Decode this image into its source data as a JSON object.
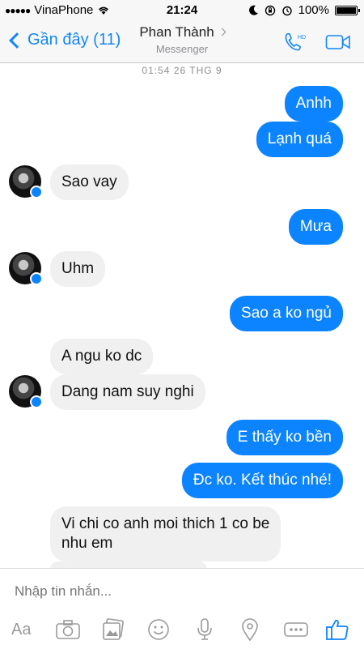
{
  "status": {
    "carrier": "VinaPhone",
    "time": "21:24",
    "battery": "100%"
  },
  "nav": {
    "back_label": "Gần đây (11)",
    "title": "Phan Thành",
    "subtitle": "Messenger"
  },
  "thread_timestamp": "01:54 26 THG 9",
  "messages": [
    {
      "side": "out",
      "text": "Anhh"
    },
    {
      "side": "out",
      "text": "Lạnh quá"
    },
    {
      "side": "in",
      "text": "Sao vay"
    },
    {
      "side": "out",
      "text": "Mưa"
    },
    {
      "side": "in",
      "text": "Uhm"
    },
    {
      "side": "out",
      "text": "Sao a ko ngủ"
    },
    {
      "side": "in",
      "text": "A ngu ko dc"
    },
    {
      "side": "in",
      "text": "Dang nam suy nghi"
    },
    {
      "side": "out",
      "text": "E thấy ko bền"
    },
    {
      "side": "out",
      "text": "Đc ko. Kết thúc nhé!"
    },
    {
      "side": "in",
      "text": "Vi chi co anh moi thich 1 co be nhu em",
      "line1": "Vi chi co anh moi thich 1 co be",
      "line2": "nhu em"
    }
  ],
  "composer": {
    "placeholder": "Nhập tin nhắn...",
    "toolbar": {
      "text_label": "Aa"
    },
    "icons": [
      "camera-icon",
      "photo-icon",
      "sticker-icon",
      "microphone-icon",
      "location-icon",
      "more-icon",
      "like-icon"
    ]
  },
  "colors": {
    "accent": "#0c84ff",
    "incoming_bubble": "#f0f0f0",
    "nav_link": "#1487f4"
  }
}
